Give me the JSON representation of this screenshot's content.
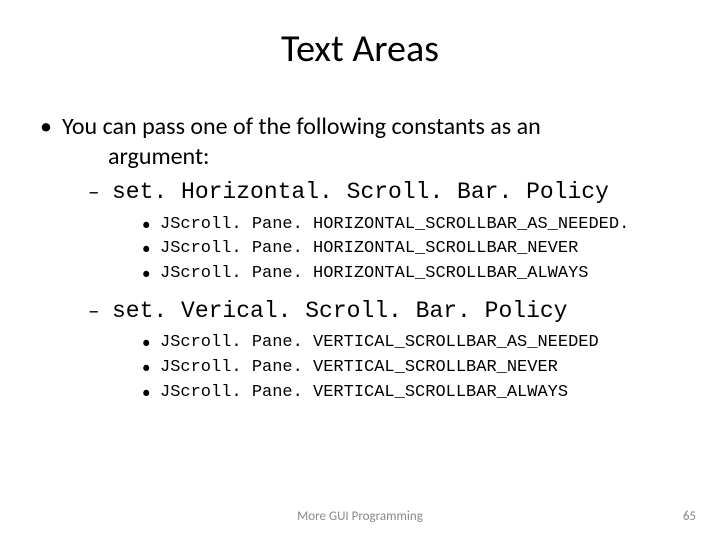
{
  "title": "Text Areas",
  "bullet_line1": "You can pass one of the following constants as an",
  "bullet_line2": "argument:",
  "methods": [
    {
      "name": "set. Horizontal. Scroll. Bar. Policy",
      "constants": [
        "JScroll. Pane. HORIZONTAL_SCROLLBAR_AS_NEEDED.",
        "JScroll. Pane. HORIZONTAL_SCROLLBAR_NEVER",
        "JScroll. Pane. HORIZONTAL_SCROLLBAR_ALWAYS"
      ]
    },
    {
      "name": "set. Verical. Scroll. Bar. Policy",
      "constants": [
        "JScroll. Pane. VERTICAL_SCROLLBAR_AS_NEEDED",
        "JScroll. Pane. VERTICAL_SCROLLBAR_NEVER",
        "JScroll. Pane. VERTICAL_SCROLLBAR_ALWAYS"
      ]
    }
  ],
  "footer_center": "More GUI Programming",
  "footer_right": "65"
}
